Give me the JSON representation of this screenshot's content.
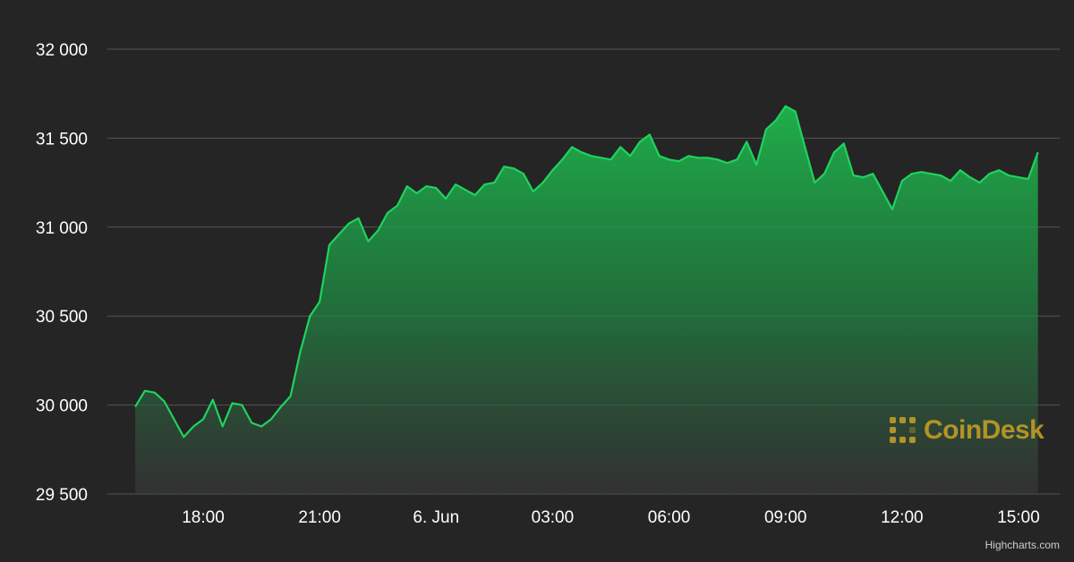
{
  "chart_data": {
    "type": "area",
    "title": "",
    "xlabel": "",
    "ylabel": "",
    "ylim": [
      29500,
      32000
    ],
    "y_ticks": [
      29500,
      30000,
      30500,
      31000,
      31500,
      32000
    ],
    "y_tick_labels": [
      "29 500",
      "30 000",
      "30 500",
      "31 000",
      "31 500",
      "32 000"
    ],
    "x_tick_labels": [
      "18:00",
      "21:00",
      "6. Jun",
      "03:00",
      "06:00",
      "09:00",
      "12:00",
      "15:00"
    ],
    "x_tick_times": [
      "2023-06-05T18:00",
      "2023-06-05T21:00",
      "2023-06-06T00:00",
      "2023-06-06T03:00",
      "2023-06-06T06:00",
      "2023-06-06T09:00",
      "2023-06-06T12:00",
      "2023-06-06T15:00"
    ],
    "grid": true,
    "legend": "none",
    "series": [
      {
        "color": "#1fd35e",
        "x": [
          "2023-06-05T16:15",
          "2023-06-05T16:30",
          "2023-06-05T16:45",
          "2023-06-05T17:00",
          "2023-06-05T17:15",
          "2023-06-05T17:30",
          "2023-06-05T17:45",
          "2023-06-05T18:00",
          "2023-06-05T18:15",
          "2023-06-05T18:30",
          "2023-06-05T18:45",
          "2023-06-05T19:00",
          "2023-06-05T19:15",
          "2023-06-05T19:30",
          "2023-06-05T19:45",
          "2023-06-05T20:00",
          "2023-06-05T20:15",
          "2023-06-05T20:30",
          "2023-06-05T20:45",
          "2023-06-05T21:00",
          "2023-06-05T21:15",
          "2023-06-05T21:30",
          "2023-06-05T21:45",
          "2023-06-05T22:00",
          "2023-06-05T22:15",
          "2023-06-05T22:30",
          "2023-06-05T22:45",
          "2023-06-05T23:00",
          "2023-06-05T23:15",
          "2023-06-05T23:30",
          "2023-06-05T23:45",
          "2023-06-06T00:00",
          "2023-06-06T00:15",
          "2023-06-06T00:30",
          "2023-06-06T00:45",
          "2023-06-06T01:00",
          "2023-06-06T01:15",
          "2023-06-06T01:30",
          "2023-06-06T01:45",
          "2023-06-06T02:00",
          "2023-06-06T02:15",
          "2023-06-06T02:30",
          "2023-06-06T02:45",
          "2023-06-06T03:00",
          "2023-06-06T03:15",
          "2023-06-06T03:30",
          "2023-06-06T03:45",
          "2023-06-06T04:00",
          "2023-06-06T04:15",
          "2023-06-06T04:30",
          "2023-06-06T04:45",
          "2023-06-06T05:00",
          "2023-06-06T05:15",
          "2023-06-06T05:30",
          "2023-06-06T05:45",
          "2023-06-06T06:00",
          "2023-06-06T06:15",
          "2023-06-06T06:30",
          "2023-06-06T06:45",
          "2023-06-06T07:00",
          "2023-06-06T07:15",
          "2023-06-06T07:30",
          "2023-06-06T07:45",
          "2023-06-06T08:00",
          "2023-06-06T08:15",
          "2023-06-06T08:30",
          "2023-06-06T08:45",
          "2023-06-06T09:00",
          "2023-06-06T09:15",
          "2023-06-06T09:30",
          "2023-06-06T09:45",
          "2023-06-06T10:00",
          "2023-06-06T10:15",
          "2023-06-06T10:30",
          "2023-06-06T10:45",
          "2023-06-06T11:00",
          "2023-06-06T11:15",
          "2023-06-06T11:30",
          "2023-06-06T11:45",
          "2023-06-06T12:00",
          "2023-06-06T12:15",
          "2023-06-06T12:30",
          "2023-06-06T12:45",
          "2023-06-06T13:00",
          "2023-06-06T13:15",
          "2023-06-06T13:30",
          "2023-06-06T13:45",
          "2023-06-06T14:00",
          "2023-06-06T14:15",
          "2023-06-06T14:30",
          "2023-06-06T14:45",
          "2023-06-06T15:00",
          "2023-06-06T15:15",
          "2023-06-06T15:30"
        ],
        "values": [
          29990,
          30080,
          30070,
          30020,
          29920,
          29820,
          29880,
          29920,
          30030,
          29880,
          30010,
          30000,
          29900,
          29880,
          29920,
          29990,
          30050,
          30300,
          30500,
          30580,
          30900,
          30960,
          31020,
          31050,
          30920,
          30980,
          31080,
          31120,
          31230,
          31190,
          31230,
          31220,
          31160,
          31240,
          31210,
          31180,
          31240,
          31250,
          31340,
          31330,
          31300,
          31200,
          31250,
          31320,
          31380,
          31450,
          31420,
          31400,
          31390,
          31380,
          31450,
          31400,
          31480,
          31520,
          31400,
          31380,
          31370,
          31400,
          31390,
          31390,
          31380,
          31360,
          31380,
          31480,
          31350,
          31550,
          31600,
          31680,
          31650,
          31450,
          31250,
          31300,
          31420,
          31470,
          31290,
          31280,
          31300,
          31200,
          31100,
          31260,
          31300,
          31310,
          31300,
          31290,
          31260,
          31320,
          31280,
          31250,
          31300,
          31320,
          31290,
          31280,
          31270,
          31420
        ]
      }
    ],
    "watermark": "CoinDesk",
    "credits": "Highcharts.com"
  },
  "colors": {
    "background": "#252525",
    "line": "#1fd35e",
    "area_top": "#1fb34a",
    "area_bottom": "#3a3a3a",
    "grid": "#555555",
    "watermark": "#c9a227"
  }
}
